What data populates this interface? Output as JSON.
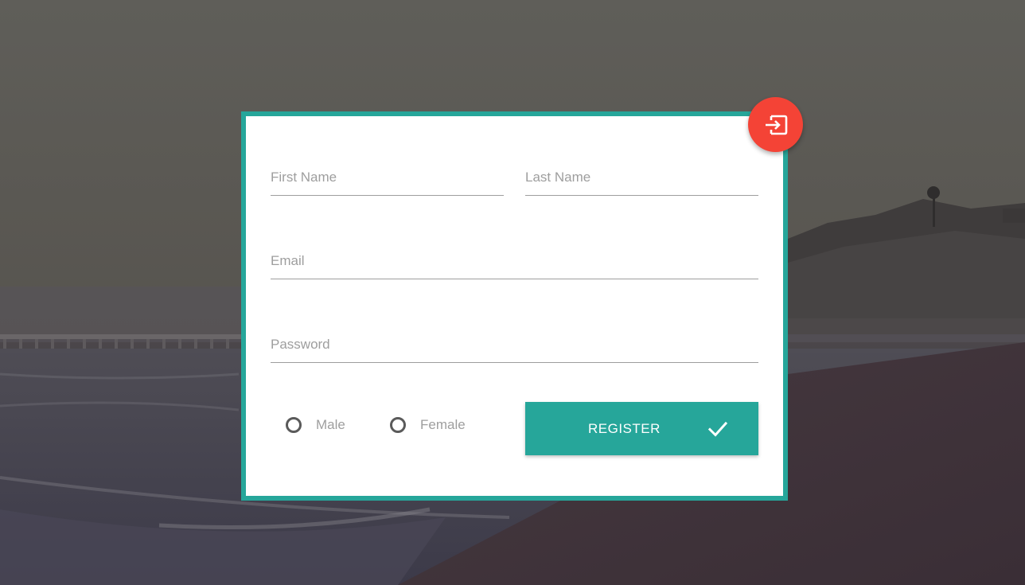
{
  "form": {
    "first_name_placeholder": "First Name",
    "last_name_placeholder": "Last Name",
    "email_placeholder": "Email",
    "password_placeholder": "Password",
    "gender_options": [
      "Male",
      "Female"
    ],
    "register_label": "REGISTER"
  },
  "icons": {
    "fab": "login-icon",
    "register": "check-icon"
  },
  "colors": {
    "accent": "#26a69a",
    "fab": "#f44336",
    "card_background": "#ffffff",
    "placeholder_text": "#9e9e9e"
  }
}
